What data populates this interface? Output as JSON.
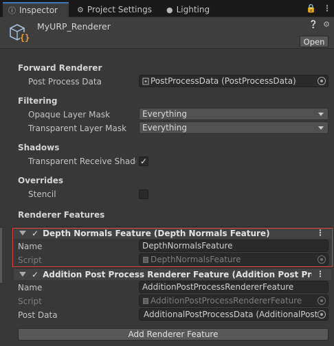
{
  "tabs": [
    {
      "label": "Inspector",
      "icon": "info-icon"
    },
    {
      "label": "Project Settings",
      "icon": "gear-icon"
    },
    {
      "label": "Lighting",
      "icon": "bulb-icon"
    }
  ],
  "tab_tools": {
    "lock_icon": "lock-icon",
    "menu_icon": "kebab-icon"
  },
  "header": {
    "title": "MyURP_Renderer",
    "open_label": "Open",
    "help_icon": "help-icon",
    "settings_icon": "gear-icon"
  },
  "forward_renderer": {
    "header": "Forward Renderer",
    "post_process_label": "Post Process Data",
    "post_process_value": "PostProcessData (PostProcessData)"
  },
  "filtering": {
    "header": "Filtering",
    "opaque_label": "Opaque Layer Mask",
    "opaque_value": "Everything",
    "transparent_label": "Transparent Layer Mask",
    "transparent_value": "Everything"
  },
  "shadows": {
    "header": "Shadows",
    "receive_label": "Transparent Receive Shadows",
    "receive_checked": true
  },
  "overrides": {
    "header": "Overrides",
    "stencil_label": "Stencil",
    "stencil_checked": false
  },
  "renderer_features": {
    "header": "Renderer Features",
    "features": [
      {
        "title": "Depth Normals Feature (Depth Normals Feature)",
        "enabled": true,
        "name_label": "Name",
        "name_value": "DepthNormalsFeature",
        "script_label": "Script",
        "script_value": "DepthNormalsFeature"
      },
      {
        "title": "Addition Post Process Renderer Feature (Addition Post Process",
        "enabled": true,
        "name_label": "Name",
        "name_value": "AdditionPostProcessRendererFeature",
        "script_label": "Script",
        "script_value": "AdditionPostProcessRendererFeature",
        "post_data_label": "Post Data",
        "post_data_value": "AdditionalPostProcessData (AdditionalPost"
      }
    ],
    "add_label": "Add Renderer Feature"
  },
  "colors": {
    "accent": "#3a79bb",
    "highlight": "#e0413c",
    "background": "#383838"
  }
}
